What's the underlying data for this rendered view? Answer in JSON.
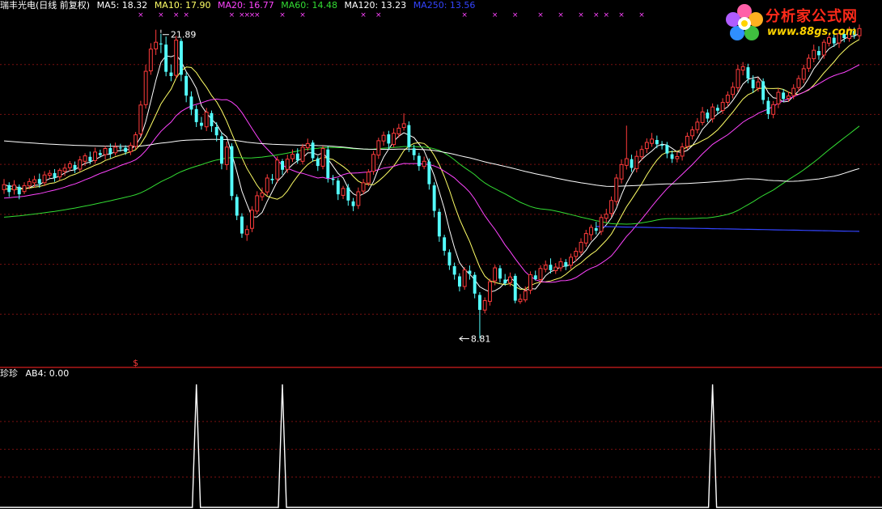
{
  "main_legend": {
    "title": "瑞丰光电(日线 前复权)",
    "items": [
      {
        "text": "MA5: 18.32",
        "color": "#ffffff"
      },
      {
        "text": "MA10: 17.90",
        "color": "#ffff66"
      },
      {
        "text": "MA20: 16.77",
        "color": "#ff44ff"
      },
      {
        "text": "MA60: 14.48",
        "color": "#33dd33"
      },
      {
        "text": "MA120: 13.23",
        "color": "#ffffff"
      },
      {
        "text": "MA250: 13.56",
        "color": "#3344ff"
      }
    ]
  },
  "sub_legend": {
    "title": "珍珍",
    "value": "AB4: 0.00"
  },
  "logo": {
    "title": "分析家公式网",
    "url": "www.88gs.com"
  },
  "colors": {
    "up": "#ff3b3b",
    "down": "#54ffff",
    "grid": "#7a1010",
    "divider": "#b01818",
    "marker": "#ff44ff",
    "ma5": "#ffffff",
    "ma10": "#ffff66",
    "ma20": "#ff44ff",
    "ma60": "#33dd33",
    "ma120": "#ffffff",
    "ma250": "#3344ff",
    "indicator": "#ffffff"
  },
  "chart_data": [
    {
      "type": "candlestick",
      "title": "瑞丰光电(日线 前复权)",
      "ylim": [
        7.8,
        22.6
      ],
      "annotations": [
        {
          "text": "21.89",
          "x": 31,
          "y": 21.89
        },
        {
          "text": "8.81",
          "x": 90,
          "y": 8.81
        }
      ],
      "dollar_marker": {
        "text": "$",
        "x": 26
      },
      "marker_symbol": "×",
      "marker_positions": [
        27,
        31,
        34,
        36,
        45,
        47,
        48,
        49,
        50,
        55,
        59,
        71,
        74,
        91,
        97,
        101,
        106,
        110,
        114,
        117,
        119,
        122,
        126
      ],
      "candles": [
        [
          15.12,
          15.33,
          15.57,
          14.94
        ],
        [
          15.31,
          15.02,
          15.43,
          14.81
        ],
        [
          15.11,
          15.31,
          15.52,
          14.91
        ],
        [
          15.24,
          14.92,
          15.34,
          14.71
        ],
        [
          15.04,
          15.29,
          15.43,
          14.93
        ],
        [
          15.28,
          15.46,
          15.6,
          15.14
        ],
        [
          15.41,
          15.54,
          15.71,
          15.22
        ],
        [
          15.57,
          15.37,
          15.8,
          15.2
        ],
        [
          15.41,
          15.74,
          15.9,
          15.27
        ],
        [
          15.73,
          15.81,
          15.95,
          15.6
        ],
        [
          15.82,
          15.62,
          15.99,
          15.45
        ],
        [
          15.66,
          15.94,
          16.03,
          15.5
        ],
        [
          15.9,
          16.03,
          16.22,
          15.7
        ],
        [
          16.05,
          16.21,
          16.33,
          15.9
        ],
        [
          16.16,
          15.98,
          16.31,
          15.82
        ],
        [
          15.99,
          16.38,
          16.54,
          15.88
        ],
        [
          16.32,
          16.55,
          16.66,
          16.12
        ],
        [
          16.51,
          16.32,
          16.73,
          16.2
        ],
        [
          16.35,
          16.71,
          16.9,
          16.22
        ],
        [
          16.67,
          16.58,
          16.81,
          16.48
        ],
        [
          16.6,
          16.86,
          16.97,
          16.39
        ],
        [
          16.88,
          16.64,
          17.07,
          16.45
        ],
        [
          16.68,
          16.92,
          17.11,
          16.56
        ],
        [
          16.9,
          16.88,
          17.06,
          16.73
        ],
        [
          16.89,
          16.72,
          17.0,
          16.59
        ],
        [
          16.73,
          16.99,
          17.12,
          16.58
        ],
        [
          16.95,
          17.44,
          17.56,
          16.82
        ],
        [
          17.48,
          18.7,
          18.88,
          17.36
        ],
        [
          18.72,
          20.13,
          20.41,
          18.55
        ],
        [
          20.15,
          21.07,
          21.32,
          19.98
        ],
        [
          21.08,
          21.36,
          21.89,
          20.82
        ],
        [
          21.31,
          21.27,
          21.72,
          20.9
        ],
        [
          21.26,
          20.11,
          21.6,
          19.92
        ],
        [
          20.08,
          19.93,
          20.42,
          19.71
        ],
        [
          19.96,
          21.45,
          21.63,
          19.82
        ],
        [
          21.41,
          19.98,
          21.52,
          19.71
        ],
        [
          19.93,
          19.1,
          20.08,
          18.82
        ],
        [
          19.06,
          18.51,
          19.28,
          18.27
        ],
        [
          18.53,
          17.98,
          18.69,
          17.77
        ],
        [
          17.95,
          17.82,
          18.2,
          17.66
        ],
        [
          17.78,
          18.4,
          18.58,
          17.6
        ],
        [
          18.36,
          17.81,
          18.47,
          17.56
        ],
        [
          17.77,
          17.42,
          17.97,
          17.16
        ],
        [
          17.38,
          16.22,
          17.53,
          15.98
        ],
        [
          16.18,
          16.92,
          17.15,
          15.95
        ],
        [
          16.96,
          14.85,
          17.08,
          14.67
        ],
        [
          14.81,
          14.02,
          14.92,
          13.83
        ],
        [
          13.98,
          13.26,
          14.12,
          13.08
        ],
        [
          13.22,
          13.43,
          13.61,
          12.95
        ],
        [
          13.48,
          14.25,
          14.42,
          13.32
        ],
        [
          14.21,
          14.86,
          15.05,
          14.08
        ],
        [
          14.82,
          14.98,
          15.21,
          14.65
        ],
        [
          15.02,
          15.61,
          15.77,
          14.88
        ],
        [
          15.58,
          15.52,
          15.78,
          15.36
        ],
        [
          15.57,
          16.37,
          16.53,
          15.4
        ],
        [
          16.33,
          15.96,
          16.42,
          15.75
        ],
        [
          15.98,
          16.41,
          16.6,
          15.82
        ],
        [
          16.43,
          16.62,
          16.82,
          16.29
        ],
        [
          16.65,
          16.36,
          16.87,
          16.21
        ],
        [
          16.32,
          16.92,
          17.06,
          16.18
        ],
        [
          16.9,
          17.07,
          17.28,
          16.75
        ],
        [
          17.11,
          16.45,
          17.21,
          16.31
        ],
        [
          16.44,
          16.12,
          16.53,
          15.91
        ],
        [
          16.11,
          16.86,
          16.98,
          15.98
        ],
        [
          16.82,
          15.61,
          16.97,
          15.42
        ],
        [
          15.58,
          15.53,
          15.74,
          15.31
        ],
        [
          15.5,
          14.92,
          15.61,
          14.68
        ],
        [
          14.88,
          15.17,
          15.28,
          14.72
        ],
        [
          15.21,
          14.66,
          15.36,
          14.44
        ],
        [
          14.62,
          14.42,
          14.77,
          14.21
        ],
        [
          14.45,
          15.03,
          15.21,
          14.3
        ],
        [
          15.06,
          15.41,
          15.57,
          14.92
        ],
        [
          15.4,
          15.86,
          15.99,
          15.27
        ],
        [
          15.89,
          16.61,
          16.76,
          15.75
        ],
        [
          16.58,
          17.19,
          17.32,
          16.42
        ],
        [
          17.18,
          17.42,
          17.58,
          16.98
        ],
        [
          17.46,
          17.07,
          17.61,
          16.83
        ],
        [
          17.03,
          17.51,
          17.72,
          16.91
        ],
        [
          17.48,
          17.72,
          17.91,
          17.32
        ],
        [
          17.75,
          17.91,
          18.35,
          17.62
        ],
        [
          17.85,
          16.91,
          18.01,
          16.71
        ],
        [
          16.87,
          16.58,
          17.02,
          16.37
        ],
        [
          16.55,
          16.12,
          16.68,
          15.92
        ],
        [
          16.1,
          16.32,
          16.52,
          15.98
        ],
        [
          16.31,
          15.35,
          16.44,
          15.12
        ],
        [
          15.3,
          14.22,
          15.43,
          13.95
        ],
        [
          14.18,
          13.14,
          14.32,
          12.91
        ],
        [
          13.1,
          12.53,
          13.21,
          12.33
        ],
        [
          12.47,
          11.91,
          12.59,
          11.72
        ],
        [
          11.88,
          11.52,
          12.03,
          11.31
        ],
        [
          11.45,
          11.02,
          11.58,
          10.81
        ],
        [
          11.02,
          11.72,
          11.84,
          10.88
        ],
        [
          11.69,
          11.55,
          11.91,
          11.31
        ],
        [
          11.51,
          10.72,
          11.63,
          10.52
        ],
        [
          10.66,
          10.03,
          10.78,
          8.81
        ],
        [
          10.02,
          10.42,
          10.56,
          9.88
        ],
        [
          10.39,
          11.22,
          11.35,
          10.21
        ],
        [
          11.26,
          11.81,
          11.93,
          11.07
        ],
        [
          11.79,
          11.35,
          11.92,
          11.18
        ],
        [
          11.31,
          11.15,
          11.55,
          11.05
        ],
        [
          11.18,
          11.42,
          11.61,
          11.03
        ],
        [
          11.47,
          10.42,
          11.56,
          10.31
        ],
        [
          10.38,
          10.48,
          10.7,
          10.28
        ],
        [
          10.45,
          10.82,
          11.02,
          10.35
        ],
        [
          10.86,
          11.52,
          11.66,
          10.7
        ],
        [
          11.49,
          11.33,
          11.69,
          11.27
        ],
        [
          11.31,
          11.78,
          11.92,
          11.16
        ],
        [
          11.75,
          11.92,
          12.12,
          11.62
        ],
        [
          11.94,
          11.71,
          12.21,
          11.57
        ],
        [
          11.69,
          11.84,
          12.01,
          11.55
        ],
        [
          11.81,
          12.07,
          12.23,
          11.66
        ],
        [
          12.05,
          11.86,
          12.18,
          11.71
        ],
        [
          11.92,
          12.26,
          12.41,
          11.76
        ],
        [
          12.29,
          12.51,
          12.67,
          12.08
        ],
        [
          12.48,
          12.89,
          13.06,
          12.35
        ],
        [
          12.86,
          13.26,
          13.42,
          12.7
        ],
        [
          13.21,
          13.52,
          13.64,
          12.97
        ],
        [
          13.49,
          13.38,
          13.76,
          13.22
        ],
        [
          13.35,
          13.94,
          14.08,
          13.2
        ],
        [
          13.91,
          14.08,
          14.31,
          13.73
        ],
        [
          14.11,
          14.66,
          14.83,
          13.96
        ],
        [
          14.62,
          15.61,
          15.78,
          14.45
        ],
        [
          15.57,
          16.18,
          16.4,
          15.38
        ],
        [
          16.15,
          16.43,
          17.83,
          15.97
        ],
        [
          16.41,
          16.04,
          16.6,
          15.87
        ],
        [
          16.01,
          16.53,
          16.77,
          15.85
        ],
        [
          16.51,
          16.82,
          16.99,
          16.35
        ],
        [
          16.86,
          17.12,
          17.29,
          16.67
        ],
        [
          17.08,
          17.26,
          17.52,
          16.93
        ],
        [
          17.22,
          17.04,
          17.41,
          16.87
        ],
        [
          17.02,
          16.98,
          17.18,
          16.82
        ],
        [
          17.01,
          16.65,
          17.14,
          16.45
        ],
        [
          16.62,
          16.42,
          16.78,
          16.25
        ],
        [
          16.43,
          16.52,
          16.73,
          16.27
        ],
        [
          16.54,
          16.93,
          17.1,
          16.35
        ],
        [
          16.95,
          17.38,
          17.54,
          16.81
        ],
        [
          17.4,
          17.65,
          17.8,
          17.24
        ],
        [
          17.66,
          17.98,
          18.15,
          17.5
        ],
        [
          17.96,
          18.41,
          18.62,
          17.84
        ],
        [
          18.38,
          18.13,
          18.52,
          17.97
        ],
        [
          18.12,
          18.62,
          18.77,
          17.96
        ],
        [
          18.58,
          18.46,
          18.72,
          18.32
        ],
        [
          18.47,
          18.81,
          18.99,
          18.32
        ],
        [
          18.82,
          19.12,
          19.28,
          18.64
        ],
        [
          19.15,
          19.46,
          19.67,
          18.98
        ],
        [
          19.44,
          20.21,
          20.41,
          19.26
        ],
        [
          20.18,
          20.33,
          20.52,
          19.96
        ],
        [
          20.3,
          19.82,
          20.45,
          19.62
        ],
        [
          19.78,
          19.41,
          19.96,
          19.22
        ],
        [
          19.42,
          19.68,
          19.87,
          19.27
        ],
        [
          19.71,
          18.92,
          19.83,
          18.74
        ],
        [
          18.88,
          18.32,
          19.04,
          18.11
        ],
        [
          18.31,
          18.72,
          18.87,
          18.14
        ],
        [
          18.75,
          19.24,
          19.41,
          18.57
        ],
        [
          19.23,
          18.96,
          19.38,
          18.82
        ],
        [
          18.98,
          19.08,
          19.27,
          18.83
        ],
        [
          19.1,
          19.41,
          19.58,
          18.95
        ],
        [
          19.44,
          19.82,
          19.96,
          19.26
        ],
        [
          19.79,
          20.24,
          20.41,
          19.62
        ],
        [
          20.26,
          20.68,
          20.85,
          20.1
        ],
        [
          20.66,
          21.02,
          21.26,
          20.51
        ],
        [
          20.99,
          20.81,
          21.19,
          20.62
        ],
        [
          20.82,
          21.36,
          21.48,
          20.66
        ],
        [
          21.32,
          21.56,
          21.73,
          21.18
        ],
        [
          21.55,
          21.31,
          21.72,
          21.16
        ],
        [
          21.33,
          21.72,
          21.89,
          21.12
        ],
        [
          21.71,
          21.54,
          21.91,
          21.36
        ],
        [
          21.52,
          21.86,
          22.02,
          21.38
        ],
        [
          21.84,
          21.66,
          21.98,
          21.51
        ],
        [
          21.64,
          21.94,
          22.11,
          21.49
        ]
      ],
      "series": [
        {
          "name": "MA5",
          "value": 18.32
        },
        {
          "name": "MA10",
          "value": 17.9
        },
        {
          "name": "MA20",
          "value": 16.77
        },
        {
          "name": "MA60",
          "value": 14.48
        },
        {
          "name": "MA120",
          "value": 13.23
        },
        {
          "name": "MA250",
          "value": 13.56
        }
      ]
    },
    {
      "type": "line",
      "title": "珍珍",
      "series": [
        {
          "name": "AB4",
          "value": 0.0,
          "spike_positions": [
            38,
            55,
            140
          ]
        }
      ],
      "ylim": [
        0,
        1
      ]
    }
  ]
}
